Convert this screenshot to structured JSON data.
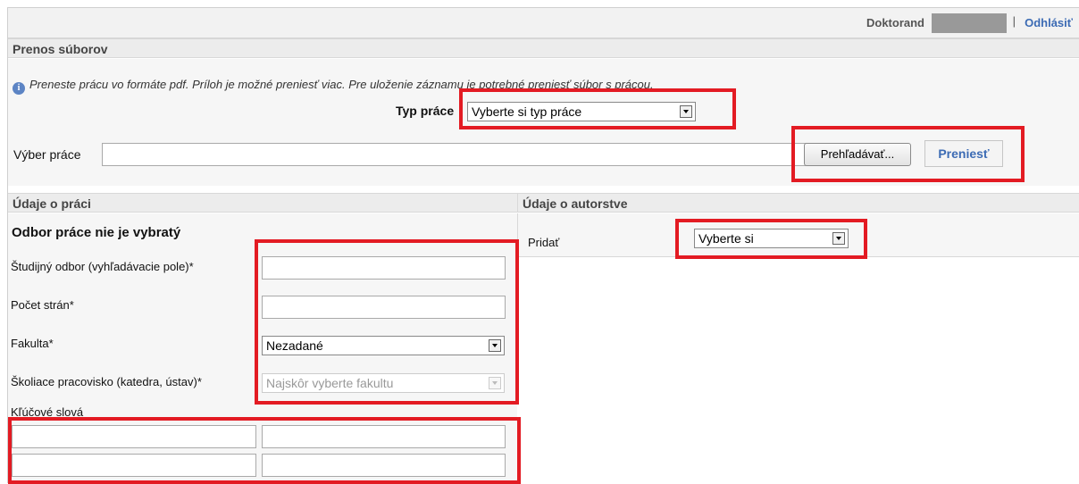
{
  "header": {
    "role": "Doktorand",
    "separator": "|",
    "logout_label": "Odhlásiť"
  },
  "transfer": {
    "title": "Prenos súborov",
    "info": "Preneste prácu vo formáte pdf. Príloh je možné preniesť viac. Pre uloženie záznamu je potrebné preniesť súbor s prácou.",
    "type_label": "Typ práce",
    "type_value": "Vyberte si typ práce",
    "file_label": "Výber práce",
    "file_value": "",
    "browse_label": "Prehľadávať...",
    "upload_label": "Preniesť"
  },
  "work": {
    "title": "Údaje o práci",
    "subtitle": "Odbor práce nie je vybratý",
    "field_label": "Študijný odbor (vyhľadávacie pole)*",
    "field_value": "",
    "pages_label": "Počet strán*",
    "pages_value": "",
    "faculty_label": "Fakulta*",
    "faculty_value": "Nezadané",
    "dept_label": "Školiace pracovisko (katedra, ústav)*",
    "dept_value": "Najskôr vyberte fakultu",
    "keywords_label": "Kľúčové slová",
    "keywords": [
      "",
      "",
      "",
      ""
    ]
  },
  "authorship": {
    "title": "Údaje o autorstve",
    "add_label": "Pridať",
    "add_value": "Vyberte si"
  },
  "colors": {
    "highlight": "#e31b23",
    "link": "#3c6bb4"
  }
}
